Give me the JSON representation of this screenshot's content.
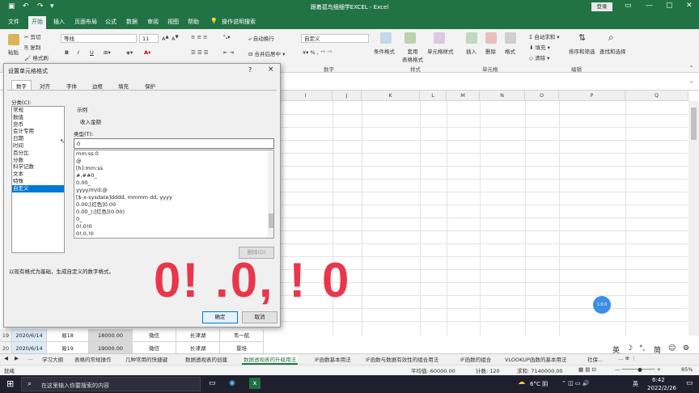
{
  "window": {
    "title": "跟着孤鸟细细学EXCEL  -  Excel",
    "login": "登录"
  },
  "tabs": [
    "文件",
    "开始",
    "插入",
    "页面布局",
    "公式",
    "数据",
    "审阅",
    "视图",
    "帮助"
  ],
  "tell_me": "操作说明搜索",
  "ribbon": {
    "paste": "粘贴",
    "cut": "剪切",
    "copy": "复制",
    "format_painter": "格式刷",
    "font_name": "等线",
    "font_size": "11",
    "bold": "B",
    "italic": "I",
    "underline": "U",
    "wrap_text": "自动换行",
    "merge_center": "合并后居中",
    "number_format": "自定义",
    "conditional_format": "条件格式",
    "table_format": "套用\n表格格式",
    "cell_style": "单元格样式",
    "insert": "插入",
    "delete": "删除",
    "format": "格式",
    "autosum": "自动求和",
    "fill": "填充",
    "clear": "清除",
    "sort_filter": "排序和筛选",
    "find_select": "查找和选择",
    "group_number": "数字",
    "group_style": "样式",
    "group_cells": "单元格",
    "group_edit": "编辑"
  },
  "columns": [
    "I",
    "J",
    "K",
    "L",
    "M",
    "N",
    "O",
    "P",
    "Q"
  ],
  "rows": [
    {
      "num": "19",
      "date": "2020/6/14",
      "name": "易18",
      "amount": "18000.00",
      "method": "微信",
      "place": "长津湖",
      "person": "韦一航"
    },
    {
      "num": "20",
      "date": "2020/6/14",
      "name": "易19",
      "amount": "19000.00",
      "method": "微信",
      "place": "长津湖",
      "person": "景培"
    }
  ],
  "sheet_tabs": [
    "学习大纲",
    "表格的常规操作",
    "几种常用的快捷键",
    "数据透视表的创建",
    "数据透视表的升级用法",
    "IF函数基本用法",
    "IF函数与数据有效性的组合用法",
    "IF函数的组合",
    "VLOOKUP函数的基本用法",
    "社保..."
  ],
  "active_sheet_index": 4,
  "status": {
    "ready": "就绪",
    "average": "平均值: 60000.00",
    "count": "计数: 120",
    "sum": "求和: 7140000.00",
    "zoom": "85%"
  },
  "ime": {
    "lang": "英",
    "mode": "简"
  },
  "taskbar": {
    "search_placeholder": "在这里输入你要搜索的内容",
    "weather": "6°C 阴",
    "lang": "英",
    "time": "6:42",
    "date": "2022/2/26"
  },
  "dialog": {
    "title": "设置单元格格式",
    "help": "?",
    "close": "×",
    "tabs": [
      "数字",
      "对齐",
      "字体",
      "边框",
      "填充",
      "保护"
    ],
    "category_label": "分类(C):",
    "categories": [
      "常规",
      "数值",
      "货币",
      "会计专用",
      "日期",
      "时间",
      "百分比",
      "分数",
      "科学记数",
      "文本",
      "特殊",
      "自定义"
    ],
    "selected_category_index": 11,
    "sample_label": "示例",
    "sample_value": "收入金额",
    "type_label": "类型(T):",
    "type_value": "0",
    "formats": [
      "mm:ss.0",
      "@",
      "[h]:mm:ss",
      "#,##0_",
      "0.00_",
      "yyyy/m/d;@",
      "[$-x-sysdate]dddd, mmmm dd, yyyy",
      "0.00;[红色]0.00",
      "0.00_);[红色](0.00)",
      "0_",
      "0!.0!0",
      "0!.0,!0"
    ],
    "delete_btn": "删除(D)",
    "description": "以现有格式为基础，生成自定义的数字格式。",
    "ok": "确定",
    "cancel": "取消"
  },
  "overlay": "0! .0, ! 0",
  "float_badge": "1.0.0"
}
